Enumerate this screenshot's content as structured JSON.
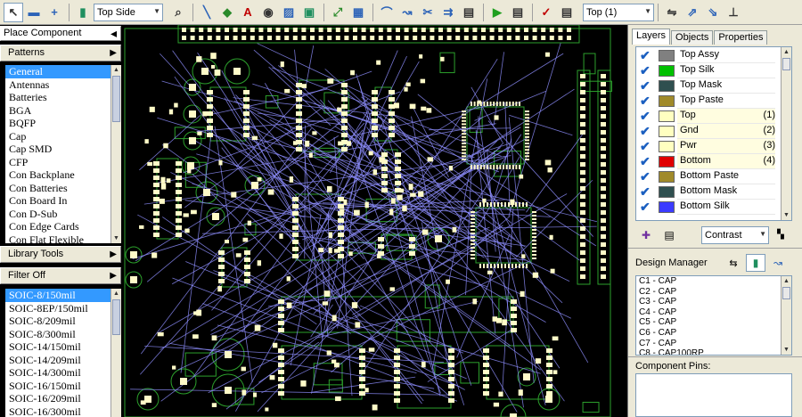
{
  "toolbar": {
    "side_select": "Top Side",
    "layer_select": "Top (1)"
  },
  "left_panel": {
    "place_component": "Place Component",
    "patterns": "Patterns",
    "pattern_items": [
      "General",
      "Antennas",
      "Batteries",
      "BGA",
      "BQFP",
      "Cap",
      "Cap SMD",
      "CFP",
      "Con Backplane",
      "Con Batteries",
      "Con Board In",
      "Con D-Sub",
      "Con Edge Cards",
      "Con Flat Flexible"
    ],
    "library_tools": "Library Tools",
    "filter": "Filter Off",
    "footprint_items": [
      "SOIC-8/150mil",
      "SOIC-8EP/150mil",
      "SOIC-8/209mil",
      "SOIC-8/300mil",
      "SOIC-14/150mil",
      "SOIC-14/209mil",
      "SOIC-14/300mil",
      "SOIC-16/150mil",
      "SOIC-16/209mil",
      "SOIC-16/300mil"
    ]
  },
  "right_panel": {
    "tabs": [
      "Layers",
      "Objects",
      "Properties"
    ],
    "layers": [
      {
        "name": "Top Assy",
        "num": "",
        "color": "#808080",
        "cell": "#ffffff"
      },
      {
        "name": "Top Silk",
        "num": "",
        "color": "#00c000",
        "cell": "#ffffff"
      },
      {
        "name": "Top Mask",
        "num": "",
        "color": "#2f4f4f",
        "cell": "#ffffff"
      },
      {
        "name": "Top Paste",
        "num": "",
        "color": "#a08a2a",
        "cell": "#ffffff"
      },
      {
        "name": "Top",
        "num": "(1)",
        "color": "#ffffc0",
        "cell": "#fffde0"
      },
      {
        "name": "Gnd",
        "num": "(2)",
        "color": "#ffffc0",
        "cell": "#fffde0"
      },
      {
        "name": "Pwr",
        "num": "(3)",
        "color": "#ffffc0",
        "cell": "#fffde0"
      },
      {
        "name": "Bottom",
        "num": "(4)",
        "color": "#e00000",
        "cell": "#fffde0"
      },
      {
        "name": "Bottom Paste",
        "num": "",
        "color": "#a08a2a",
        "cell": "#ffffff"
      },
      {
        "name": "Bottom Mask",
        "num": "",
        "color": "#2f4f4f",
        "cell": "#ffffff"
      },
      {
        "name": "Bottom Silk",
        "num": "",
        "color": "#3b3bff",
        "cell": "#ffffff"
      }
    ],
    "contrast": "Contrast",
    "design_manager": "Design Manager",
    "dm_items": [
      "C1 - CAP",
      "C2 - CAP",
      "C3 - CAP",
      "C4 - CAP",
      "C5 - CAP",
      "C6 - CAP",
      "C7 - CAP",
      "C8 - CAP100RP"
    ],
    "component_pins": "Component Pins:"
  }
}
